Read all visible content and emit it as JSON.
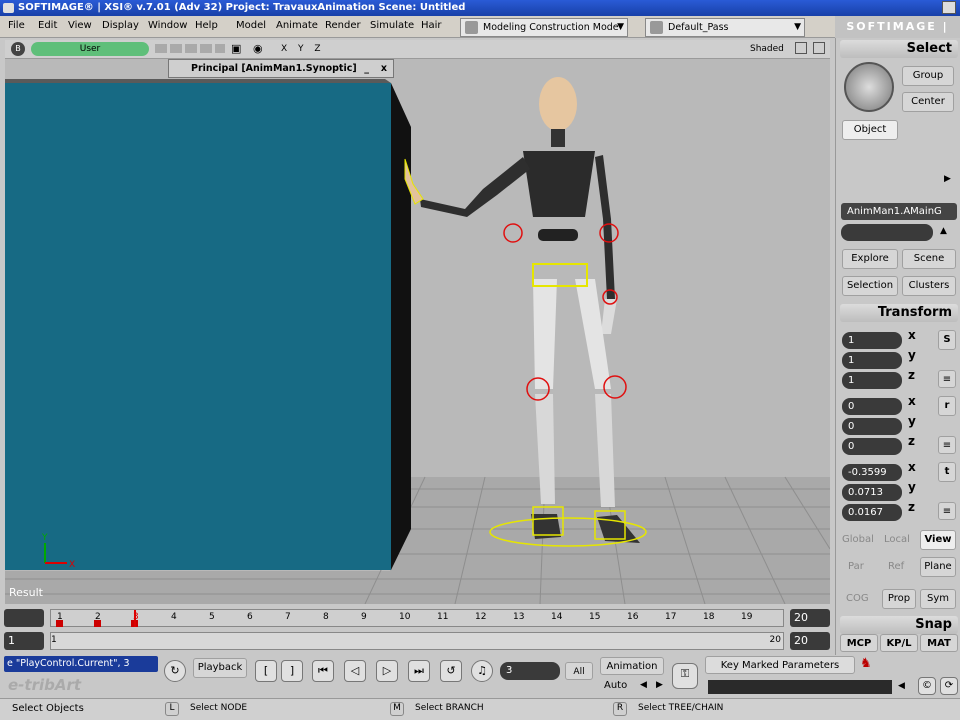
{
  "window": {
    "title": "SOFTIMAGE® | XSI® v.7.01 (Adv 32) Project: TravauxAnimation    Scene: Untitled",
    "brand": "SOFTIMAGE | XSI"
  },
  "menu": [
    "File",
    "Edit",
    "View",
    "Display",
    "Window",
    "Help",
    "Model",
    "Animate",
    "Render",
    "Simulate",
    "Hair"
  ],
  "mode_combo": "Modeling Construction Mode",
  "pass_combo": "Default_Pass",
  "viewport": {
    "camera": "User",
    "axes": "X Y Z",
    "shading": "Shaded",
    "result_label": "Result"
  },
  "synoptic": {
    "title": "Principal [AnimMan1.Synoptic]",
    "min": "_",
    "close": "x"
  },
  "timeline": {
    "ticks": [
      "1",
      "2",
      "3",
      "4",
      "5",
      "6",
      "7",
      "8",
      "9",
      "10",
      "11",
      "12",
      "13",
      "14",
      "15",
      "16",
      "17",
      "18",
      "19"
    ],
    "start": "1",
    "end": "20",
    "range_start": "1",
    "range_end": "20",
    "range_end_field": "20"
  },
  "playback": {
    "script_field": "e \"PlayControl.Current\", 3",
    "playback_label": "Playback",
    "frame": "3",
    "all": "All",
    "animation": "Animation",
    "auto": "Auto",
    "key_marked": "Key Marked Parameters",
    "logo": "e-tribArt"
  },
  "status": {
    "left": "Select Objects",
    "l_key": "L",
    "l_text": "Select NODE",
    "m_key": "M",
    "m_text": "Select BRANCH",
    "r_key": "R",
    "r_text": "Select TREE/CHAIN"
  },
  "select_panel": {
    "title": "Select",
    "group": "Group",
    "center": "Center",
    "object": "Object",
    "selected_name": "AnimMan1.AMainG",
    "explore": "Explore",
    "scene": "Scene",
    "selection": "Selection",
    "clusters": "Clusters"
  },
  "transform_panel": {
    "title": "Transform",
    "scale": [
      "1",
      "1",
      "1"
    ],
    "rotate": [
      "0",
      "0",
      "0"
    ],
    "translate": [
      "-0.3599",
      "0.0713",
      "0.0167"
    ],
    "s": "S",
    "r": "r",
    "t": "t",
    "x": "x",
    "y": "y",
    "z": "z",
    "global": "Global",
    "local": "Local",
    "view": "View",
    "par": "Par",
    "ref": "Ref",
    "plane": "Plane",
    "cog": "COG",
    "prop": "Prop",
    "sym": "Sym"
  },
  "snap_panel": {
    "title": "Snap",
    "mcp": "MCP",
    "kpl": "KP/L",
    "mat": "MAT"
  }
}
